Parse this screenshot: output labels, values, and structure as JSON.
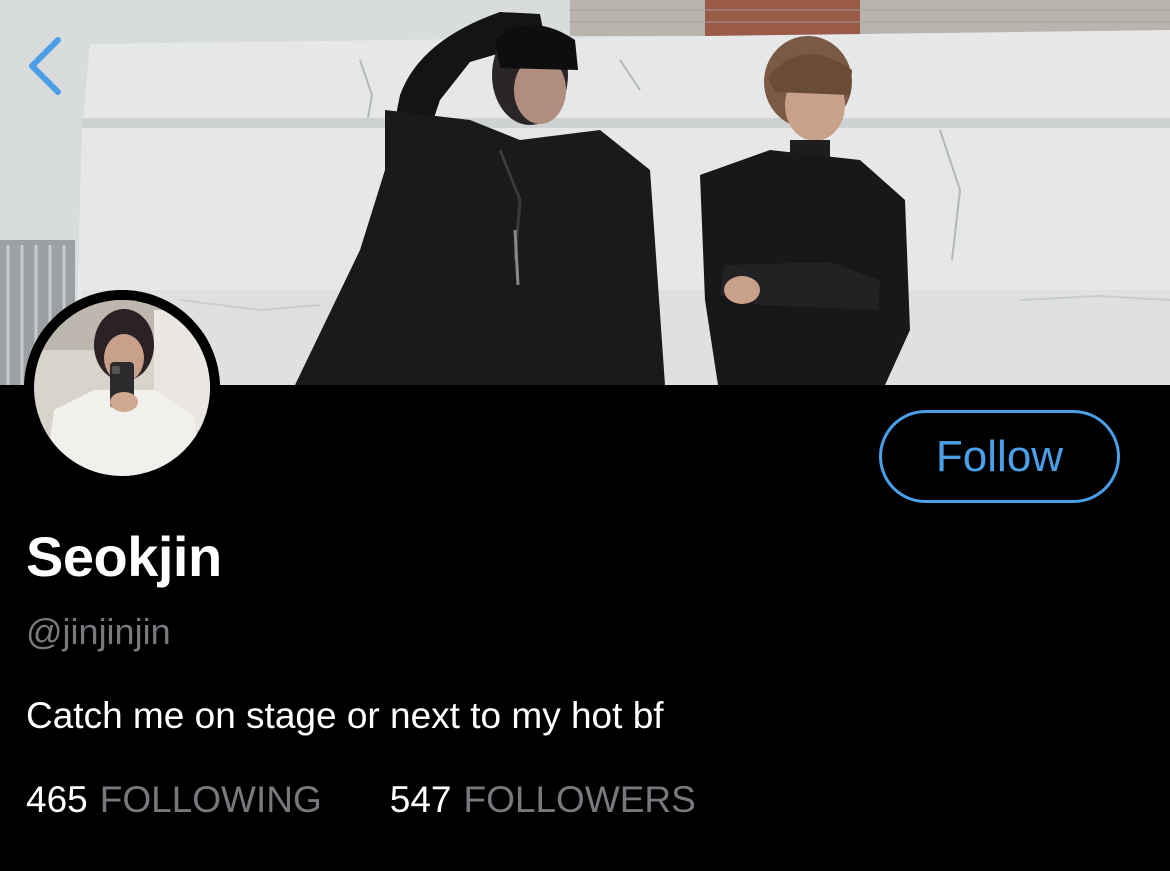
{
  "header": {
    "back_icon": "chevron-left-icon",
    "accent_color": "#4a9fe8"
  },
  "profile": {
    "display_name": "Seokjin",
    "handle": "@jinjinjin",
    "bio": "Catch me on stage or next to my hot bf",
    "follow_label": "Follow"
  },
  "stats": {
    "following_count": "465",
    "following_label": "FOLLOWING",
    "followers_count": "547",
    "followers_label": "FOLLOWERS"
  }
}
